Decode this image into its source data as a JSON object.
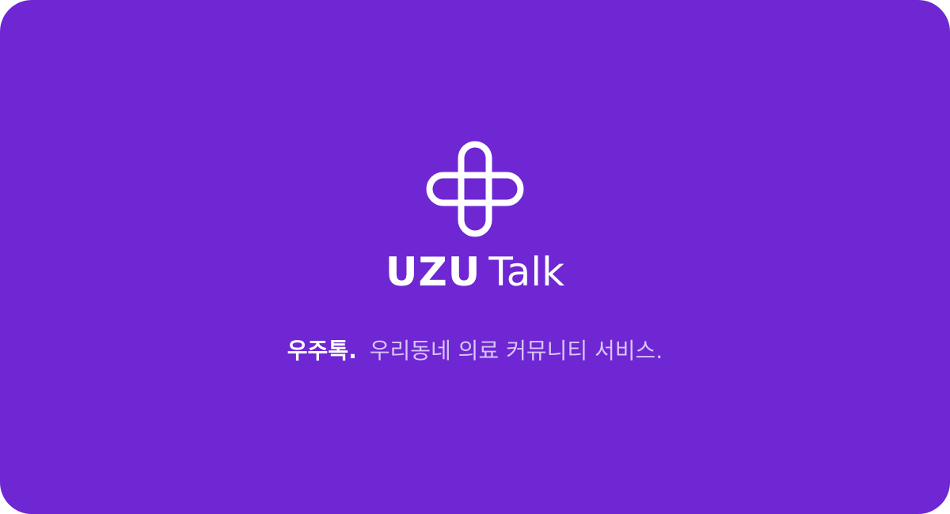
{
  "colors": {
    "background": "#6e27d3",
    "logo": "#ffffff",
    "text_primary": "#ffffff",
    "text_secondary": "#d9c5f5"
  },
  "logo": {
    "icon": "cross-pill-logo-icon"
  },
  "wordmark": {
    "bold": "UZU",
    "light": "Talk"
  },
  "tagline": {
    "bold": "우주톡.",
    "rest": "우리동네 의료 커뮤니티 서비스."
  }
}
